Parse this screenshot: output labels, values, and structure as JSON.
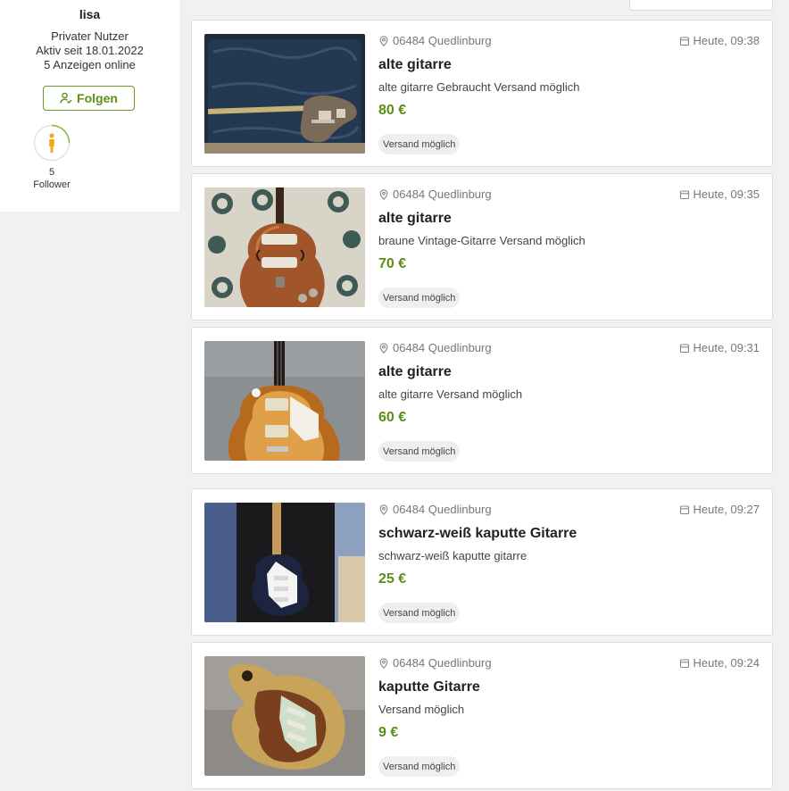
{
  "profile": {
    "name": "lisa",
    "user_type": "Privater Nutzer",
    "active_since": "Aktiv seit 18.01.2022",
    "ads_online": "5 Anzeigen online",
    "follow_label": "Folgen",
    "follower_count": "5",
    "follower_label": "Follower"
  },
  "listings": [
    {
      "location": "06484 Quedlinburg",
      "date": "Heute, 09:38",
      "title": "alte gitarre",
      "description": "alte gitarre Gebraucht Versand möglich",
      "price": "80 €",
      "badge": "Versand möglich",
      "image": "guitar-in-case-photo"
    },
    {
      "location": "06484 Quedlinburg",
      "date": "Heute, 09:35",
      "title": "alte gitarre",
      "description": "braune Vintage-Gitarre Versand möglich",
      "price": "70 €",
      "badge": "Versand möglich",
      "image": "violin-bass-photo"
    },
    {
      "location": "06484 Quedlinburg",
      "date": "Heute, 09:31",
      "title": "alte gitarre",
      "description": "alte gitarre Versand möglich",
      "price": "60 €",
      "badge": "Versand möglich",
      "image": "sunburst-les-paul-photo"
    },
    {
      "location": "06484 Quedlinburg",
      "date": "Heute, 09:27",
      "title": "schwarz-weiß kaputte Gitarre",
      "description": "schwarz-weiß kaputte gitarre",
      "price": "25 €",
      "badge": "Versand möglich",
      "image": "black-white-strat-photo"
    },
    {
      "location": "06484 Quedlinburg",
      "date": "Heute, 09:24",
      "title": "kaputte Gitarre",
      "description": "Versand möglich",
      "price": "9 €",
      "badge": "Versand möglich",
      "image": "worn-strat-body-photo"
    }
  ],
  "colors": {
    "accent_green": "#5b8f13",
    "page_bg": "#f1f1f1",
    "card_bg": "#ffffff"
  }
}
